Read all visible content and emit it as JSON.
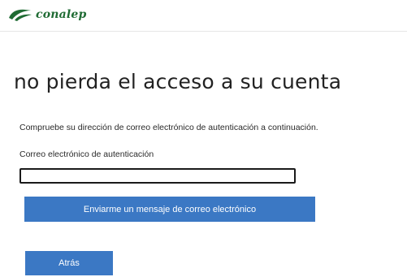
{
  "header": {
    "logo_text": "conalep",
    "brand_color": "#1f6b33"
  },
  "main": {
    "title": "no pierda el acceso a su cuenta",
    "instruction": "Compruebe su dirección de correo electrónico de autenticación a continuación.",
    "email_label": "Correo electrónico de autenticación",
    "email_value": "",
    "send_email_button": "Enviarme un mensaje de correo electrónico",
    "back_button": "Atrás",
    "button_color": "#3b78c4"
  }
}
